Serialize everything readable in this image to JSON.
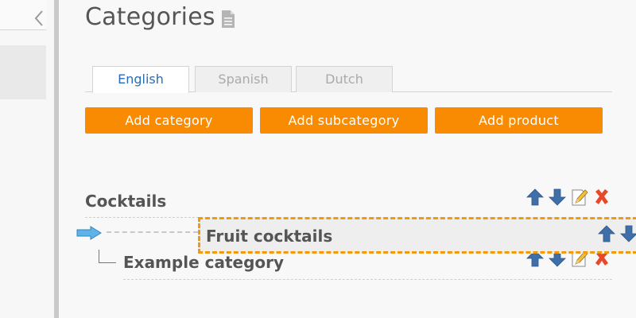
{
  "page": {
    "title": "Categories",
    "title_icon": "document-icon"
  },
  "sidebar": {
    "collapse_icon": "chevron-left-icon"
  },
  "tabs": [
    {
      "label": "English",
      "active": true
    },
    {
      "label": "Spanish",
      "active": false
    },
    {
      "label": "Dutch",
      "active": false
    }
  ],
  "buttons": {
    "add_category": "Add category",
    "add_subcategory": "Add subcategory",
    "add_product": "Add product"
  },
  "tree": {
    "items": [
      {
        "label": "Cocktails",
        "level": 0,
        "actions": [
          "move-up-icon",
          "move-down-icon",
          "edit-icon",
          "delete-icon"
        ]
      },
      {
        "label": "Example category",
        "level": 1,
        "actions": [
          "move-up-icon",
          "move-down-icon",
          "edit-icon",
          "delete-icon"
        ]
      }
    ],
    "dragging": {
      "label": "Fruit cocktails",
      "actions": [
        "move-up-icon",
        "move-down-icon"
      ]
    }
  },
  "colors": {
    "accent": "#f98b02",
    "tab_active_text": "#2a6db5",
    "drag_border": "#f29a0c",
    "arrow_blue": "#3f6fa8",
    "delete_red": "#e8472a",
    "drag_arrow": "#5fb3e6"
  }
}
